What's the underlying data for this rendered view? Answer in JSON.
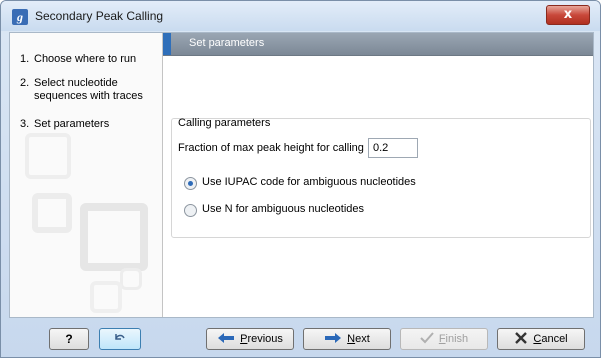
{
  "window": {
    "title": "Secondary Peak Calling",
    "app_icon_glyph": "g",
    "close_glyph": "x"
  },
  "sidebar": {
    "steps": [
      {
        "number": "1.",
        "label": "Choose where to run"
      },
      {
        "number": "2.",
        "label": "Select nucleotide sequences with traces"
      },
      {
        "number": "3.",
        "label": "Set parameters"
      }
    ]
  },
  "panel": {
    "header": "Set parameters",
    "group_title": "Calling parameters",
    "fraction_label": "Fraction of max peak height for calling",
    "fraction_value": "0.2",
    "radio_iupac": "Use IUPAC code for ambiguous nucleotides",
    "radio_n": "Use N for ambiguous nucleotides",
    "selected_option": "iupac"
  },
  "buttons": {
    "help": "?",
    "previous_prefix": "",
    "previous_u": "P",
    "previous_rest": "revious",
    "next_u": "N",
    "next_rest": "ext",
    "finish_u": "F",
    "finish_rest": "inish",
    "cancel_u": "C",
    "cancel_rest": "ancel"
  },
  "colors": {
    "accent": "#2f6fba",
    "close": "#c8483a",
    "header_bg": "#8a96a3"
  },
  "icons": {
    "app": "app-logo-icon",
    "close": "close-icon",
    "help": "help-icon",
    "restore": "restore-defaults-icon",
    "previous": "arrow-left-icon",
    "next": "arrow-right-icon",
    "finish": "checkmark-icon",
    "cancel": "x-cancel-icon"
  }
}
